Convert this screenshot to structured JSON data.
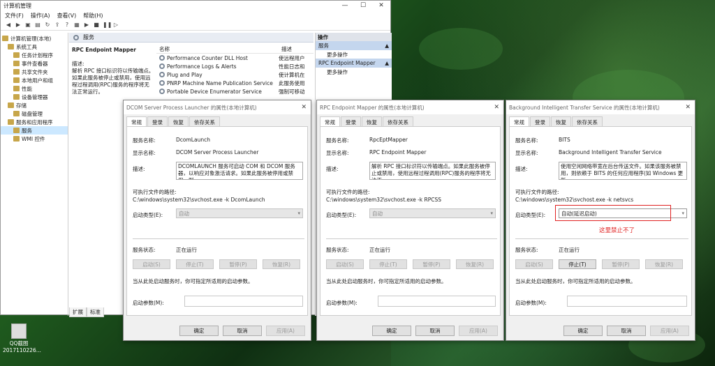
{
  "mmc": {
    "title": "计算机管理",
    "menu": [
      "文件(F)",
      "操作(A)",
      "查看(V)",
      "帮助(H)"
    ],
    "tree": [
      {
        "label": "计算机管理(本地)",
        "indent": 0
      },
      {
        "label": "系统工具",
        "indent": 1
      },
      {
        "label": "任务计划程序",
        "indent": 2
      },
      {
        "label": "事件查看器",
        "indent": 2
      },
      {
        "label": "共享文件夹",
        "indent": 2
      },
      {
        "label": "本地用户和组",
        "indent": 2
      },
      {
        "label": "性能",
        "indent": 2
      },
      {
        "label": "设备管理器",
        "indent": 2
      },
      {
        "label": "存储",
        "indent": 1
      },
      {
        "label": "磁盘管理",
        "indent": 2
      },
      {
        "label": "服务和应用程序",
        "indent": 1
      },
      {
        "label": "服务",
        "indent": 2,
        "selected": true
      },
      {
        "label": "WMI 控件",
        "indent": 2
      }
    ],
    "pane_title": "服务",
    "selected_service": "RPC Endpoint Mapper",
    "desc_label": "描述:",
    "desc_text": "解析 RPC 接口标识符以传输端点。如果此服务被停止或禁用，使用远程过程调用(RPC)服务的程序将无法正常运行。",
    "columns": [
      "名称",
      "描述"
    ],
    "services": [
      {
        "name": "Performance Counter DLL Host",
        "desc": "使远程用户"
      },
      {
        "name": "Performance Logs & Alerts",
        "desc": "性能日志和"
      },
      {
        "name": "Plug and Play",
        "desc": "使计算机在"
      },
      {
        "name": "PNRP Machine Name Publication Service",
        "desc": "此服务使用"
      },
      {
        "name": "Portable Device Enumerator Service",
        "desc": "强制可移动"
      }
    ],
    "bottom_tabs": [
      "扩展",
      "标准"
    ],
    "actions_header": "操作",
    "action_sections": [
      {
        "title": "服务",
        "items": [
          "更多操作"
        ]
      },
      {
        "title": "RPC Endpoint Mapper",
        "items": [
          "更多操作"
        ]
      }
    ]
  },
  "labels": {
    "tabs": [
      "常规",
      "登录",
      "恢复",
      "依存关系"
    ],
    "service_name": "服务名称:",
    "display_name": "显示名称:",
    "description": "描述:",
    "exe_path": "可执行文件的路径:",
    "startup_type": "启动类型(E):",
    "service_status": "服务状态:",
    "hint": "当从此处启动服务时，你可指定所适用的启动参数。",
    "start_params": "启动参数(M):",
    "btn_start": "启动(S)",
    "btn_stop": "停止(T)",
    "btn_pause": "暂停(P)",
    "btn_resume": "恢复(R)",
    "ok": "确定",
    "cancel": "取消",
    "apply": "应用(A)"
  },
  "dialogs": [
    {
      "title": "DCOM Server Process Launcher 的属性(本地计算机)",
      "service_name": "DcomLaunch",
      "display_name": "DCOM Server Process Launcher",
      "description": "DCOMLAUNCH 服务可启动 COM 和 DCOM 服务器，以响应对象激活请求。如果此服务被停用或禁用，则",
      "exe_path": "C:\\windows\\system32\\svchost.exe -k DcomLaunch",
      "startup_type": "自动",
      "status": "正在运行"
    },
    {
      "title": "RPC Endpoint Mapper 的属性(本地计算机)",
      "service_name": "RpcEptMapper",
      "display_name": "RPC Endpoint Mapper",
      "description": "解析 RPC 接口标识符以传输端点。如果此服务被停止或禁用，使用远程过程调用(RPC)服务的程序将无法正",
      "exe_path": "C:\\windows\\system32\\svchost.exe -k RPCSS",
      "startup_type": "自动",
      "status": "正在运行"
    },
    {
      "title": "Background Intelligent Transfer Service 的属性(本地计算机)",
      "service_name": "BITS",
      "display_name": "Background Intelligent Transfer Service",
      "description": "使用空闲网络带宽在后台传送文件。如果该服务被禁用，则依赖于 BITS 的任何应用程序(如 Windows 更新",
      "exe_path": "C:\\windows\\system32\\svchost.exe -k netsvcs",
      "startup_type": "自动(延迟启动)",
      "status": "正在运行",
      "annotation": "这里禁止不了"
    }
  ],
  "desktop_icon": {
    "label": "QQ截图",
    "sub": "2017110226..."
  },
  "colors": {
    "annotation_red": "#e02020",
    "selection_blue": "#cce8ff",
    "action_blue": "#c4d6ee"
  }
}
